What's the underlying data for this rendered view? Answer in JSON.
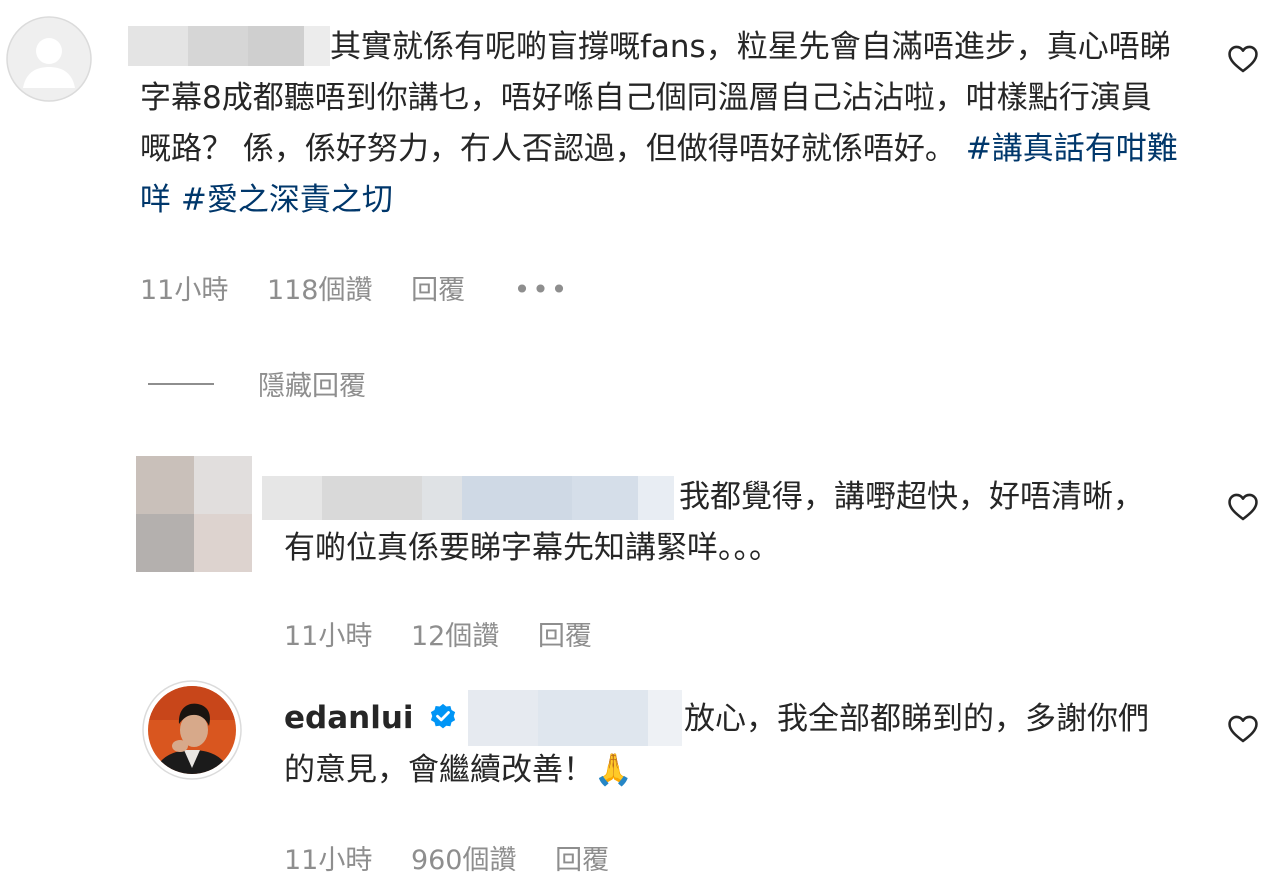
{
  "comments": [
    {
      "text": "其實就係有呢啲盲撐嘅fans，粒星先會自滿唔進步，真心唔睇字幕8成都聽唔到你講乜，唔好喺自己個同溫層自己沾沾啦，咁樣點行演員嘅路？ 係，係好努力，冇人否認過，但做得唔好就係唔好。",
      "hashtags": "#講真話有咁難咩 #愛之深責之切",
      "time": "11小時",
      "likes": "118個讚",
      "reply": "回覆",
      "more": "•••"
    },
    {
      "text": "我都覺得，講嘢超快，好唔清晰，有啲位真係要睇字幕先知講緊咩。。。",
      "time": "11小時",
      "likes": "12個讚",
      "reply": "回覆"
    },
    {
      "username": "edanlui",
      "text": "放心，我全部都睇到的，多謝你們的意見，會繼續改善！🙏",
      "time": "11小時",
      "likes": "960個讚",
      "reply": "回覆"
    }
  ],
  "thread": {
    "hide_replies": "隱藏回覆"
  },
  "icons": {
    "heart": "heart-icon",
    "verified": "verified-badge-icon",
    "avatar_placeholder": "default-avatar-icon"
  },
  "colors": {
    "text": "#262626",
    "meta": "#8e8e8e",
    "hashtag": "#00376b",
    "verified": "#0095f6"
  }
}
